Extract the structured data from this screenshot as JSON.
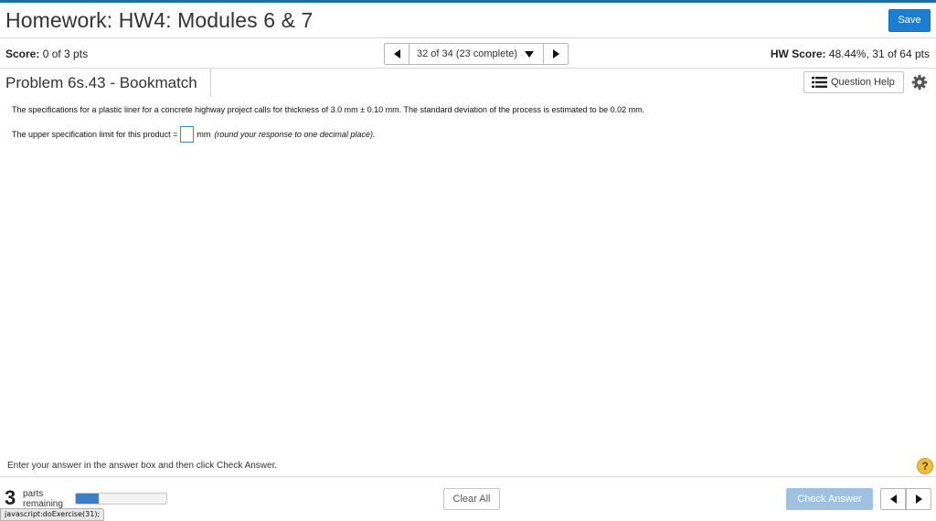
{
  "header": {
    "title": "Homework: HW4: Modules 6 & 7",
    "save_label": "Save"
  },
  "score_bar": {
    "score_label": "Score:",
    "score_value": "0 of 3 pts",
    "nav_position": "32 of 34 (23 complete)",
    "hw_score_label": "HW Score:",
    "hw_score_value": "48.44%, 31 of 64 pts"
  },
  "problem": {
    "title": "Problem 6s.43 - Bookmatch",
    "question_help_label": "Question Help",
    "statement": "The specifications for a plastic liner for a concrete highway project calls for thickness of 3.0 mm ± 0.10 mm.  The standard deviation of the process is estimated to be 0.02 mm.",
    "answer_prefix": "The upper specification limit for this product =",
    "answer_unit": "mm",
    "answer_hint": "(round your response to one decimal place).",
    "answer_value": ""
  },
  "footer": {
    "instruction": "Enter your answer in the answer box and then click Check Answer.",
    "help_symbol": "?",
    "parts_count": "3",
    "parts_label_line1": "parts",
    "parts_label_line2": "remaining",
    "progress_fraction": 0.25,
    "clear_all_label": "Clear All",
    "check_answer_label": "Check Answer",
    "status_text": "javascript:doExercise(31);"
  },
  "colors": {
    "accent": "#1b6ea8",
    "save_button": "#1a7fd3",
    "check_answer_disabled": "#9fc2e3",
    "help_icon": "#f0c03a",
    "progress": "#3c7fc8"
  }
}
